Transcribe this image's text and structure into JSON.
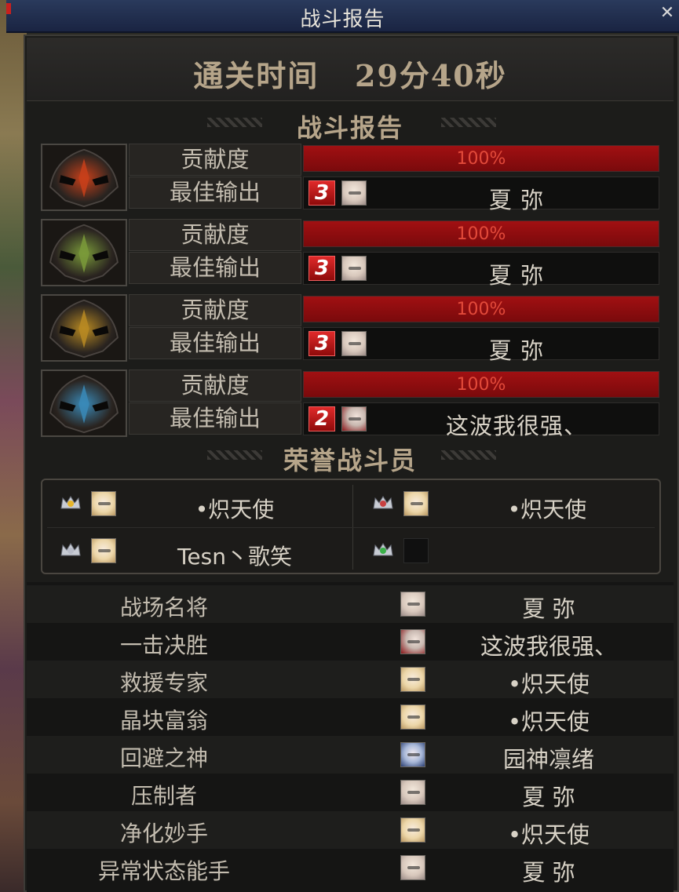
{
  "window": {
    "title": "战斗报告",
    "close_symbol": "✕"
  },
  "clear_time": {
    "label": "通关时间",
    "value": "29分40秒"
  },
  "battle_report": {
    "heading": "战斗报告",
    "contribution_label": "贡献度",
    "best_output_label": "最佳输出",
    "bosses": [
      {
        "icon": "fire-mask-icon",
        "color": "#c8401a",
        "contribution_pct": 100,
        "contribution_text": "100%",
        "best_rank": "3",
        "best_player": "夏 弥"
      },
      {
        "icon": "leaf-mask-icon",
        "color": "#7a9a3a",
        "contribution_pct": 100,
        "contribution_text": "100%",
        "best_rank": "3",
        "best_player": "夏 弥"
      },
      {
        "icon": "gold-mask-icon",
        "color": "#b88a22",
        "contribution_pct": 100,
        "contribution_text": "100%",
        "best_rank": "3",
        "best_player": "夏 弥"
      },
      {
        "icon": "ice-mask-icon",
        "color": "#3a8ab8",
        "contribution_pct": 100,
        "contribution_text": "100%",
        "best_rank": "2",
        "best_player": "这波我很强、"
      }
    ]
  },
  "honor": {
    "heading": "荣誉战斗员",
    "members": [
      {
        "crown": "gold-crown-icon",
        "name": "•炽天使"
      },
      {
        "crown": "red-crown-icon",
        "name": "•炽天使"
      },
      {
        "crown": "silver-crown-icon",
        "name": "Tesn丶歌笑"
      },
      {
        "crown": "green-crown-icon",
        "name": ""
      }
    ]
  },
  "awards": [
    {
      "title": "战场名将",
      "player": "夏 弥"
    },
    {
      "title": "一击决胜",
      "player": "这波我很强、"
    },
    {
      "title": "救援专家",
      "player": "•炽天使"
    },
    {
      "title": "晶块富翁",
      "player": "•炽天使"
    },
    {
      "title": "回避之神",
      "player": "园神凛绪"
    },
    {
      "title": "压制者",
      "player": "夏 弥"
    },
    {
      "title": "净化妙手",
      "player": "•炽天使"
    },
    {
      "title": "异常状态能手",
      "player": "夏 弥"
    }
  ]
}
